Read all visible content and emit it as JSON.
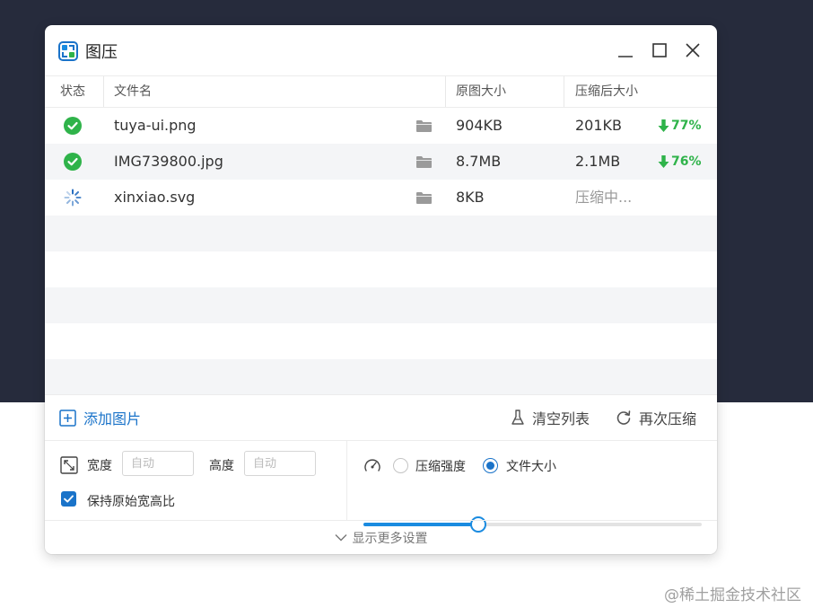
{
  "app": {
    "title": "图压"
  },
  "table": {
    "columns": {
      "status": "状态",
      "name": "文件名",
      "original": "原图大小",
      "compressed": "压缩后大小"
    },
    "rows": [
      {
        "status": "done",
        "name": "tuya-ui.png",
        "original": "904KB",
        "compressed": "201KB",
        "reduction": "77%"
      },
      {
        "status": "done",
        "name": "IMG739800.jpg",
        "original": "8.7MB",
        "compressed": "2.1MB",
        "reduction": "76%"
      },
      {
        "status": "loading",
        "name": "xinxiao.svg",
        "original": "8KB",
        "compressed": "压缩中..."
      }
    ]
  },
  "actions": {
    "add": "添加图片",
    "clear": "清空列表",
    "recompress": "再次压缩"
  },
  "settings": {
    "width_label": "宽度",
    "width_placeholder": "自动",
    "height_label": "高度",
    "height_placeholder": "自动",
    "keep_ratio_label": "保持原始宽高比",
    "keep_ratio_checked": true,
    "mode_strength_label": "压缩强度",
    "mode_filesize_label": "文件大小",
    "selected_mode": "filesize",
    "slider_value": 0.34
  },
  "footer": {
    "more_settings": "显示更多设置"
  },
  "watermark": "@稀土掘金技术社区",
  "colors": {
    "accent": "#1a73c9",
    "success": "#2fb34a",
    "dark_bg": "#262b3c"
  }
}
